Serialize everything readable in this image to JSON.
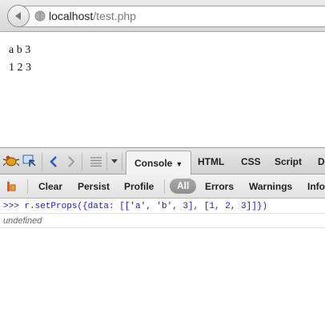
{
  "browser": {
    "url_host": "localhost",
    "url_path": "/test.php"
  },
  "page": {
    "row1": "a b 3",
    "row2": "1 2 3"
  },
  "firebug": {
    "tabs": {
      "console": "Console",
      "html": "HTML",
      "css": "CSS",
      "script": "Script",
      "dom": "D"
    },
    "console_toolbar": {
      "clear": "Clear",
      "persist": "Persist",
      "profile": "Profile",
      "all": "All",
      "errors": "Errors",
      "warnings": "Warnings",
      "info": "Info"
    },
    "console_lines": {
      "command": ">>> r.setProps({data: [['a', 'b', 3], [1, 2, 3]]})",
      "result": "undefined"
    }
  },
  "colors": {
    "command_text": "#1b1bb3",
    "result_text": "#6a6a6a",
    "active_filter": "#9a9a9a"
  }
}
